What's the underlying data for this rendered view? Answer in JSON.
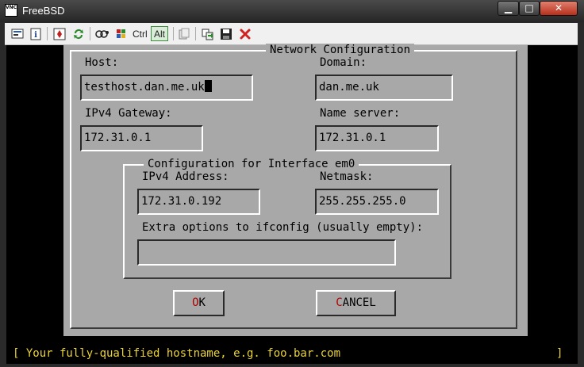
{
  "window": {
    "title": "FreeBSD",
    "icon_label": "VNC",
    "controls": {
      "minimize": "▁",
      "maximize": "□",
      "close": "✕"
    }
  },
  "toolbar": {
    "items": [
      {
        "name": "options-icon"
      },
      {
        "name": "info-icon"
      },
      {
        "name": "full-screen-icon"
      },
      {
        "name": "refresh-icon"
      },
      {
        "name": "ctrl-alt-del-icon"
      },
      {
        "name": "send-start-icon"
      },
      {
        "name": "ctrl-key",
        "label": "Ctrl"
      },
      {
        "name": "alt-key",
        "label": "Alt"
      },
      {
        "name": "clipboard-icon"
      },
      {
        "name": "transfer-icon"
      },
      {
        "name": "save-icon"
      },
      {
        "name": "disconnect-icon"
      }
    ]
  },
  "dialog": {
    "title": "Network Configuration",
    "host_label": "Host:",
    "host_value": "testhost.dan.me.uk",
    "domain_label": "Domain:",
    "domain_value": "dan.me.uk",
    "gateway_label": "IPv4 Gateway:",
    "gateway_value": "172.31.0.1",
    "nameserver_label": "Name server:",
    "nameserver_value": "172.31.0.1",
    "interface": {
      "title": "Configuration for Interface em0",
      "address_label": "IPv4 Address:",
      "address_value": "172.31.0.192",
      "netmask_label": "Netmask:",
      "netmask_value": "255.255.255.0",
      "extra_label": "Extra options to ifconfig (usually empty):",
      "extra_value": ""
    },
    "ok_hotkey": "O",
    "ok_rest": "K",
    "cancel_hotkey": "C",
    "cancel_rest": "ANCEL"
  },
  "status": {
    "text": "[ Your fully-qualified hostname, e.g. foo.bar.com",
    "close_bracket": "]"
  },
  "colors": {
    "dialog_bg": "#a8a8a8",
    "hotkey": "#b00000",
    "status_text": "#e8d23a",
    "screen_bg": "#000000"
  }
}
